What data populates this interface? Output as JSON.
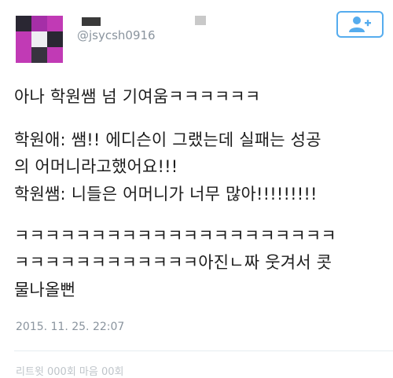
{
  "tweet": {
    "handle": "@jsycsh0916",
    "lines": [
      "아나 학원쌤 넘 기여움ㅋㅋㅋㅋㅋㅋ",
      "학원애: 쌤!! 에디슨이 그랬는데 실패는 성공",
      "의 어머니라고했어요!!!",
      "학원쌤: 니들은 어머니가 너무 많아!!!!!!!!!",
      "ㅋㅋㅋㅋㅋㅋㅋㅋㅋㅋㅋㅋㅋㅋㅋㅋㅋㅋㅋㅋㅋ",
      "ㅋㅋㅋㅋㅋㅋㅋㅋㅋㅋㅋㅋ아진ㄴ짜 웃겨서 콧",
      "물나올뻔"
    ],
    "timestamp": "2015. 11. 25. 22:07",
    "stats_text": "리트윗 000회 마음 00회"
  },
  "follow_button": {
    "icon": "add-user-icon",
    "color": "#55acee"
  },
  "avatar_colors": [
    [
      "#2a2733",
      "#a52fa7",
      "#c13ab5"
    ],
    [
      "#c13ab5",
      "#eeeef2",
      "#2a2733"
    ],
    [
      "#c13ab5",
      "#38333f",
      "#c13ab5"
    ]
  ]
}
